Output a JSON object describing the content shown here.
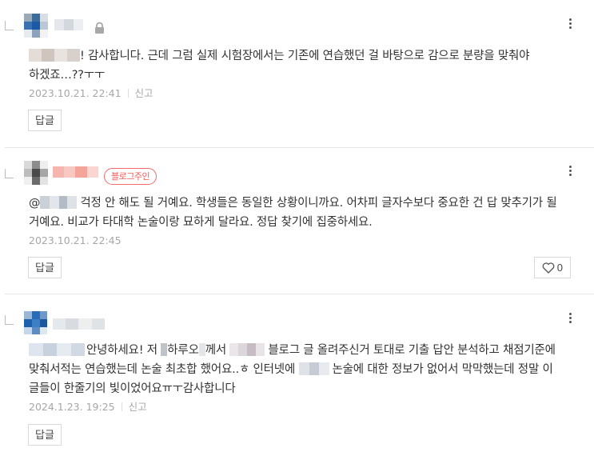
{
  "comments": [
    {
      "text_after_name": "! 감사합니다. 근데 그럼 실제 시험장에서는 기존에 연습했던 걸 바탕으로 감으로 분량을 맞춰야 하겠죠…??ㅜㅜ",
      "date": "2023.10.21. 22:41",
      "report": "신고",
      "reply": "답글"
    },
    {
      "badge": "블로그주인",
      "mention": "@",
      "text": "걱정 안 해도 될 거예요. 학생들은 동일한 상황이니까요. 어차피 글자수보다 중요한 건 답 맞추기가 될 거예요. 비교가 타대학 논술이랑 묘하게 달라요. 정답 찾기에 집중하세요.",
      "date": "2023.10.21. 22:45",
      "reply": "답글",
      "likes": "0"
    },
    {
      "text_1": "안녕하세요! 저",
      "text_name": "하루오",
      "text_2": "께서",
      "text_3": "블로그 글 올려주신거 토대로 기출 답안 분석하고 채점기준에 맞춰서적는 연습했는데 논술 최초합 했어요..ㅎ 인터넷에",
      "text_4": "논술에 대한 정보가 없어서 막막했는데 정말 이 글들이 한줄기의 빛이었어요ㅠㅜ감사합니다",
      "date": "2024.1.23. 19:25",
      "report": "신고",
      "reply": "답글"
    }
  ],
  "colors": {
    "accent_badge": "#f05a5a",
    "meta_text": "#a7a7a7",
    "separator": "#e6e6e6"
  },
  "icons": [
    "reply-arrow-icon",
    "lock-icon",
    "more-vertical-icon",
    "heart-outline-icon"
  ]
}
